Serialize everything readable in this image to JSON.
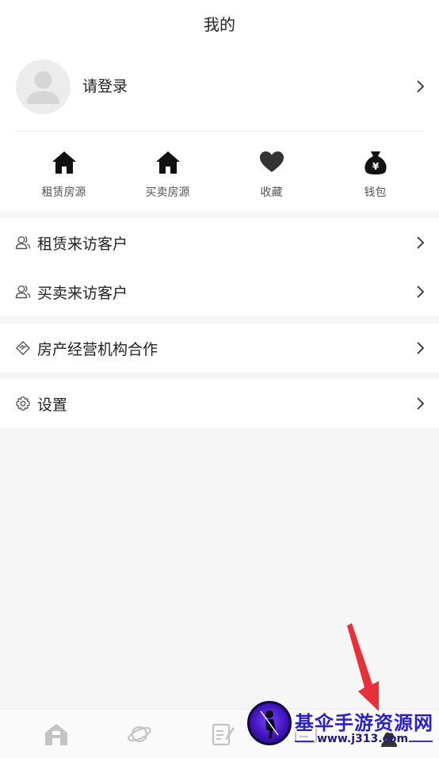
{
  "header": {
    "title": "我的"
  },
  "profile": {
    "login_text": "请登录"
  },
  "quick_links": [
    {
      "label": "租赁房源",
      "icon": "house-icon"
    },
    {
      "label": "买卖房源",
      "icon": "house-icon"
    },
    {
      "label": "收藏",
      "icon": "heart-icon"
    },
    {
      "label": "钱包",
      "icon": "money-bag-icon"
    }
  ],
  "menu": {
    "group1": [
      {
        "label": "租赁来访客户",
        "icon": "users-icon"
      },
      {
        "label": "买卖来访客户",
        "icon": "users-icon"
      }
    ],
    "group2": [
      {
        "label": "房产经营机构合作",
        "icon": "handshake-icon"
      }
    ],
    "group3": [
      {
        "label": "设置",
        "icon": "gear-icon"
      }
    ]
  },
  "watermark": {
    "title": "基伞手游资源网",
    "url": "www.j313.com"
  },
  "colors": {
    "background": "#f6f6f6",
    "card": "#ffffff",
    "arrow": "#e8303a",
    "watermark": "#2a20c8"
  }
}
